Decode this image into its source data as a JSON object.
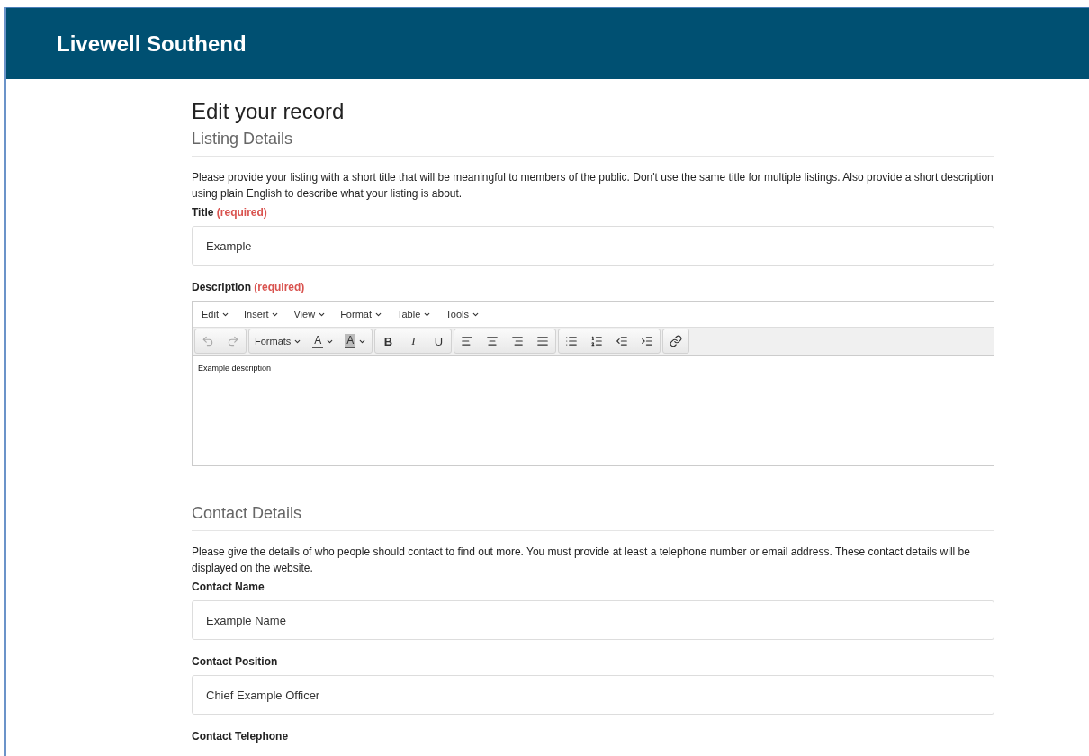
{
  "header": {
    "title": "Livewell Southend"
  },
  "page_title": "Edit your record",
  "sections": [
    {
      "heading": "Listing Details",
      "intro": "Please provide your listing with a short title that will be meaningful to members of the public. Don't use the same title for multiple listings. Also provide a short description using plain English to describe what your listing is about.",
      "fields": [
        {
          "kind": "input",
          "label": "Title",
          "required": "(required)",
          "value": "Example"
        },
        {
          "kind": "editor",
          "label": "Description",
          "required": "(required)",
          "menu": [
            "Edit",
            "Insert",
            "View",
            "Format",
            "Table",
            "Tools"
          ],
          "toolbar": [
            [
              {
                "kind": "undo",
                "disabled": true
              },
              {
                "kind": "redo",
                "disabled": true
              }
            ],
            [
              {
                "kind": "dropdown",
                "label": "Formats"
              },
              {
                "kind": "text-color",
                "label": "A"
              },
              {
                "kind": "back-color",
                "label": "A"
              }
            ],
            [
              {
                "kind": "bold",
                "label": "B"
              },
              {
                "kind": "italic",
                "label": "I"
              },
              {
                "kind": "underline",
                "label": "U"
              }
            ],
            [
              {
                "kind": "align-left"
              },
              {
                "kind": "align-center"
              },
              {
                "kind": "align-right"
              },
              {
                "kind": "align-justify"
              }
            ],
            [
              {
                "kind": "bullet-list"
              },
              {
                "kind": "numbered-list"
              },
              {
                "kind": "outdent"
              },
              {
                "kind": "indent"
              }
            ],
            [
              {
                "kind": "link"
              }
            ]
          ],
          "value": "Example description"
        }
      ]
    },
    {
      "heading": "Contact Details",
      "intro": "Please give the details of who people should contact to find out more. You must provide at least a telephone number or email address. These contact details will be displayed on the website.",
      "fields": [
        {
          "kind": "input",
          "label": "Contact Name",
          "value": "Example Name"
        },
        {
          "kind": "input",
          "label": "Contact Position",
          "value": "Chief Example Officer"
        },
        {
          "kind": "label",
          "label": "Contact Telephone"
        }
      ]
    }
  ]
}
